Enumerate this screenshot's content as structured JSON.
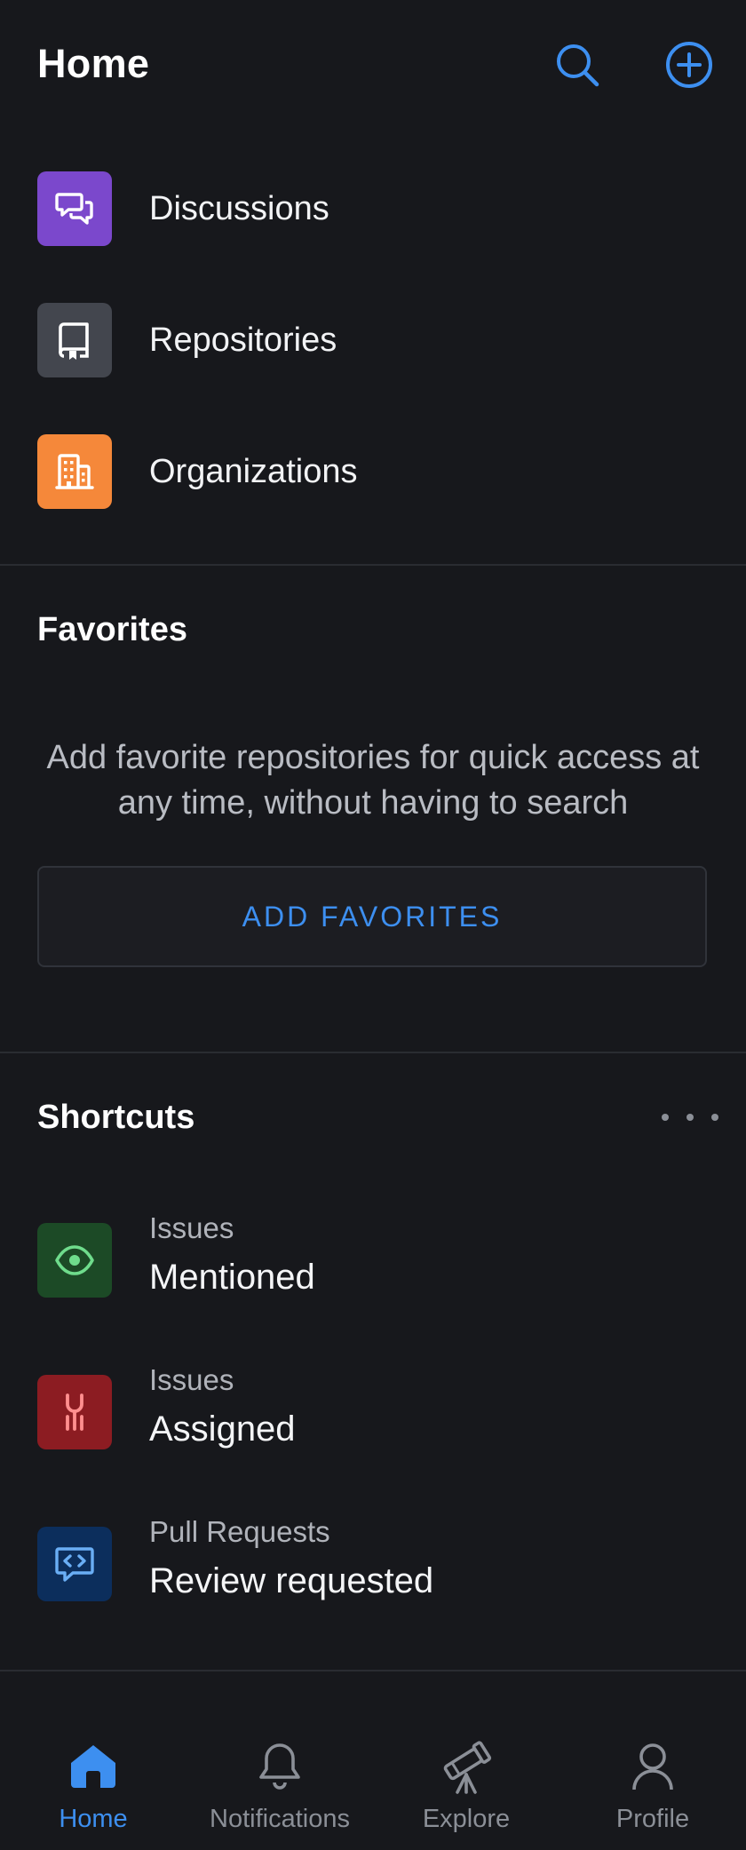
{
  "header": {
    "title": "Home",
    "search_icon": "search-icon",
    "create_icon": "plus-circle-icon",
    "accent_color": "#3d8ff0"
  },
  "nav": {
    "items": [
      {
        "label": "Discussions",
        "icon": "discussion-icon",
        "color": "#7b48cc"
      },
      {
        "label": "Repositories",
        "icon": "repo-icon",
        "color": "#43464e"
      },
      {
        "label": "Organizations",
        "icon": "organization-icon",
        "color": "#f5883a"
      }
    ]
  },
  "favorites": {
    "title": "Favorites",
    "description": "Add favorite repositories for quick access at any time, without having to search",
    "button_label": "ADD FAVORITES"
  },
  "shortcuts": {
    "title": "Shortcuts",
    "more_icon": "more-horizontal-icon",
    "items": [
      {
        "subtitle": "Issues",
        "title": "Mentioned",
        "icon": "eye-icon",
        "color": "#1c4a26",
        "icon_color": "#6fdc8c"
      },
      {
        "subtitle": "Issues",
        "title": "Assigned",
        "icon": "wrench-icon",
        "color": "#8c1c22",
        "icon_color": "#ff8f8f"
      },
      {
        "subtitle": "Pull Requests",
        "title": "Review requested",
        "icon": "code-review-icon",
        "color": "#0c2e5c",
        "icon_color": "#6aaef5"
      }
    ]
  },
  "tabbar": {
    "tabs": [
      {
        "label": "Home",
        "icon": "home-icon",
        "active": true
      },
      {
        "label": "Notifications",
        "icon": "bell-icon",
        "active": false
      },
      {
        "label": "Explore",
        "icon": "telescope-icon",
        "active": false
      },
      {
        "label": "Profile",
        "icon": "person-icon",
        "active": false
      }
    ]
  }
}
